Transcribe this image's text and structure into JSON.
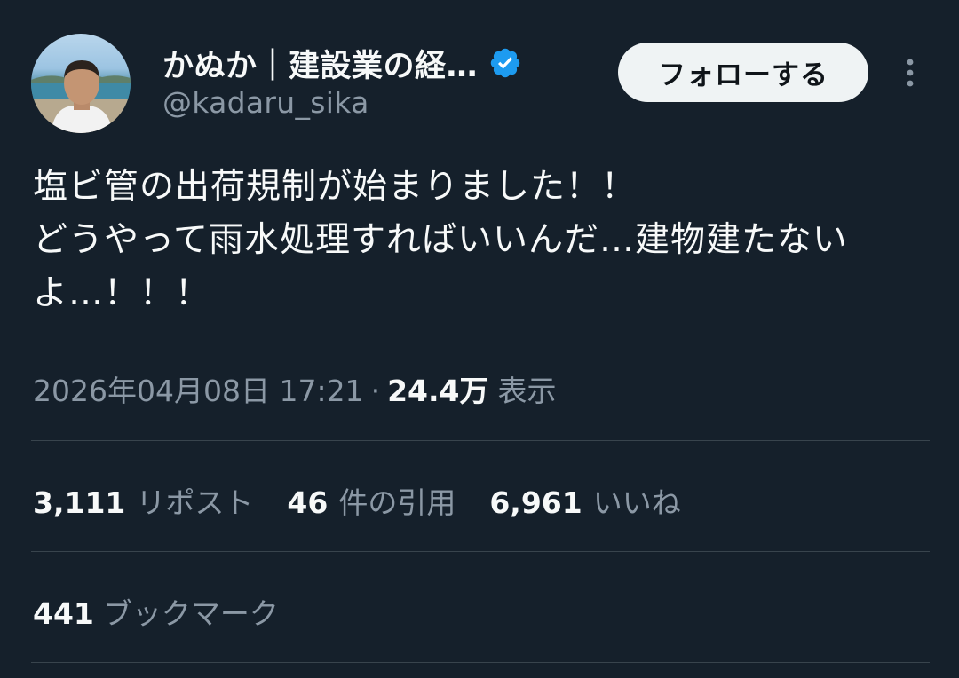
{
  "author": {
    "display_name": "かぬか｜建設業の経…",
    "handle": "@kadaru_sika",
    "verified": true
  },
  "actions": {
    "follow_label": "フォローする"
  },
  "tweet": {
    "text": "塩ビ管の出荷規制が始まりました！！\nどうやって雨水処理すればいいんだ…建物建たないよ…！！！",
    "timestamp": "2026年04月08日 17:21",
    "separator": "·",
    "views_count": "24.4万",
    "views_label": "表示"
  },
  "stats": {
    "reposts": {
      "count": "3,111",
      "label": "リポスト"
    },
    "quotes": {
      "count": "46",
      "label": "件の引用"
    },
    "likes": {
      "count": "6,961",
      "label": "いいね"
    },
    "bookmarks": {
      "count": "441",
      "label": "ブックマーク"
    }
  },
  "colors": {
    "background": "#15202b",
    "text_primary": "#f7f9f9",
    "text_secondary": "#8b98a5",
    "divider": "#38444d",
    "verified_badge": "#1d9bf0",
    "follow_button_bg": "#eff3f4"
  },
  "icons": {
    "verified": "verified-badge-icon",
    "more": "more-options-icon"
  }
}
